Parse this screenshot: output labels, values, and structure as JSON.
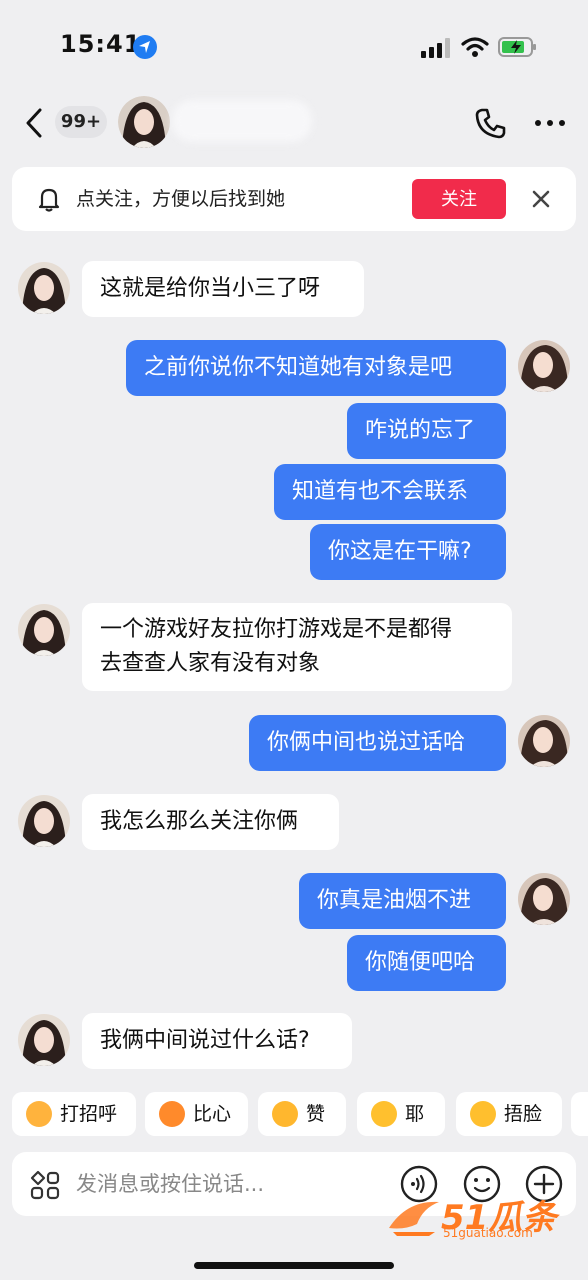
{
  "status": {
    "time": "15:41"
  },
  "nav": {
    "unread": "99+"
  },
  "banner": {
    "text": "点关注，方便以后找到她",
    "button": "关注"
  },
  "messages": [
    {
      "dir": "in",
      "text": "这就是给你当小三了呀"
    },
    {
      "dir": "out",
      "text": "之前你说你不知道她有对象是吧"
    },
    {
      "dir": "out",
      "text": "咋说的忘了"
    },
    {
      "dir": "out",
      "text": "知道有也不会联系"
    },
    {
      "dir": "out",
      "text": "你这是在干嘛?"
    },
    {
      "dir": "in",
      "text": "一个游戏好友拉你打游戏是不是都得",
      "text2": "去查查人家有没有对象"
    },
    {
      "dir": "out",
      "text": "你俩中间也说过话哈"
    },
    {
      "dir": "in",
      "text": "我怎么那么关注你俩"
    },
    {
      "dir": "out",
      "text": "你真是油烟不进"
    },
    {
      "dir": "out",
      "text": "你随便吧哈"
    },
    {
      "dir": "in",
      "text": "我俩中间说过什么话?"
    }
  ],
  "quick_replies": [
    {
      "label": "打招呼",
      "icon": "wave-emoji",
      "color": "#ffb33d"
    },
    {
      "label": "比心",
      "icon": "heart-hands-emoji",
      "color": "#ff8a2b"
    },
    {
      "label": "赞",
      "icon": "thumbs-up-emoji",
      "color": "#ffb72e"
    },
    {
      "label": "耶",
      "icon": "wink-emoji",
      "color": "#ffc02e"
    },
    {
      "label": "捂脸",
      "icon": "facepalm-emoji",
      "color": "#ffbf2e"
    }
  ],
  "input": {
    "placeholder": "发消息或按住说话..."
  },
  "watermark": {
    "brand": "51瓜条",
    "url": "51guatiao.com"
  },
  "colors": {
    "outgoing": "#3d7bf4",
    "follow": "#f12b4b",
    "watermark": "#ff7a21"
  }
}
